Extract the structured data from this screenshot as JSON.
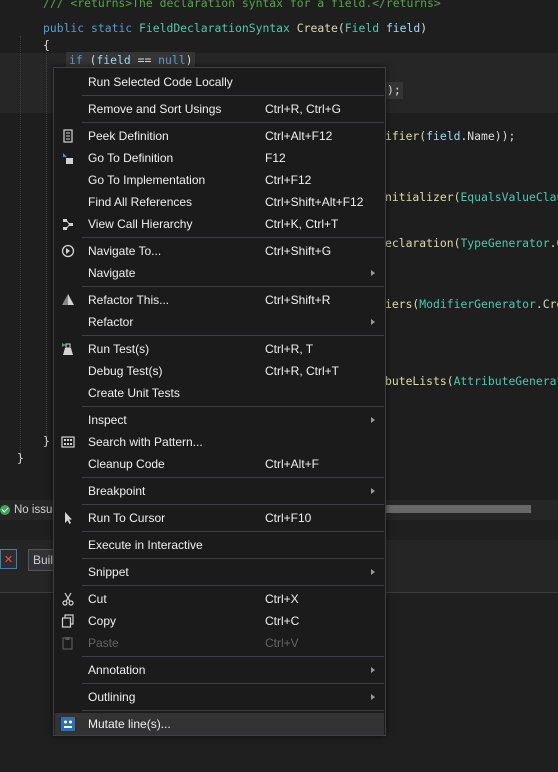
{
  "editor": {
    "comment_line": "/// <returns>The declaration syntax for a field.</returns>",
    "sig_kw1": "public",
    "sig_kw2": "static",
    "sig_type": "FieldDeclarationSyntax",
    "sig_method": "Create",
    "sig_paramtype": "Field",
    "sig_param": "field",
    "brace_open": "{",
    "if_kw": "if",
    "if_var": "field",
    "if_op": "==",
    "if_null": "null",
    "frag_1": ");",
    "frag_2a": "ifier(",
    "frag_2b": "field",
    "frag_2c": ".Name));",
    "frag_3a": "nitializer(",
    "frag_3b": "EqualsValueClause",
    "frag_4a": "eclaration(",
    "frag_4b": "TypeGenerator",
    "frag_4c": ".Cr",
    "frag_5a": "iers(",
    "frag_5b": "ModifierGenerator",
    "frag_5c": ".Creat",
    "frag_6a": "buteLists(",
    "frag_6b": "AttributeGenerato",
    "brace_close_inner": "}",
    "brace_close_outer": "}"
  },
  "status": {
    "issues_text": "No issue"
  },
  "lower_panel": {
    "build_label": "Buil"
  },
  "context_menu": {
    "items": [
      {
        "label": "Run Selected Code Locally",
        "shortcut": "",
        "icon": "",
        "submenu": false,
        "disabled": false
      },
      {
        "label": "Remove and Sort Usings",
        "shortcut": "Ctrl+R, Ctrl+G",
        "icon": "",
        "submenu": false,
        "disabled": false
      },
      {
        "label": "Peek Definition",
        "shortcut": "Ctrl+Alt+F12",
        "icon": "peek-definition-icon",
        "submenu": false,
        "disabled": false
      },
      {
        "label": "Go To Definition",
        "shortcut": "F12",
        "icon": "go-to-definition-icon",
        "submenu": false,
        "disabled": false
      },
      {
        "label": "Go To Implementation",
        "shortcut": "Ctrl+F12",
        "icon": "",
        "submenu": false,
        "disabled": false
      },
      {
        "label": "Find All References",
        "shortcut": "Ctrl+Shift+Alt+F12",
        "icon": "",
        "submenu": false,
        "disabled": false
      },
      {
        "label": "View Call Hierarchy",
        "shortcut": "Ctrl+K, Ctrl+T",
        "icon": "call-hierarchy-icon",
        "submenu": false,
        "disabled": false
      },
      {
        "label": "Navigate To...",
        "shortcut": "Ctrl+Shift+G",
        "icon": "navigate-to-icon",
        "submenu": false,
        "disabled": false
      },
      {
        "label": "Navigate",
        "shortcut": "",
        "icon": "",
        "submenu": true,
        "disabled": false
      },
      {
        "label": "Refactor This...",
        "shortcut": "Ctrl+Shift+R",
        "icon": "refactor-icon",
        "submenu": false,
        "disabled": false
      },
      {
        "label": "Refactor",
        "shortcut": "",
        "icon": "",
        "submenu": true,
        "disabled": false
      },
      {
        "label": "Run Test(s)",
        "shortcut": "Ctrl+R, T",
        "icon": "run-tests-icon",
        "submenu": false,
        "disabled": false
      },
      {
        "label": "Debug Test(s)",
        "shortcut": "Ctrl+R, Ctrl+T",
        "icon": "",
        "submenu": false,
        "disabled": false
      },
      {
        "label": "Create Unit Tests",
        "shortcut": "",
        "icon": "",
        "submenu": false,
        "disabled": false
      },
      {
        "label": "Inspect",
        "shortcut": "",
        "icon": "",
        "submenu": true,
        "disabled": false
      },
      {
        "label": "Search with Pattern...",
        "shortcut": "",
        "icon": "search-pattern-icon",
        "submenu": false,
        "disabled": false
      },
      {
        "label": "Cleanup Code",
        "shortcut": "Ctrl+Alt+F",
        "icon": "",
        "submenu": false,
        "disabled": false
      },
      {
        "label": "Breakpoint",
        "shortcut": "",
        "icon": "",
        "submenu": true,
        "disabled": false
      },
      {
        "label": "Run To Cursor",
        "shortcut": "Ctrl+F10",
        "icon": "cursor-icon",
        "submenu": false,
        "disabled": false
      },
      {
        "label": "Execute in Interactive",
        "shortcut": "",
        "icon": "",
        "submenu": false,
        "disabled": false
      },
      {
        "label": "Snippet",
        "shortcut": "",
        "icon": "",
        "submenu": true,
        "disabled": false
      },
      {
        "label": "Cut",
        "shortcut": "Ctrl+X",
        "icon": "scissors-icon",
        "submenu": false,
        "disabled": false
      },
      {
        "label": "Copy",
        "shortcut": "Ctrl+C",
        "icon": "copy-icon",
        "submenu": false,
        "disabled": false
      },
      {
        "label": "Paste",
        "shortcut": "Ctrl+V",
        "icon": "paste-icon",
        "submenu": false,
        "disabled": true
      },
      {
        "label": "Annotation",
        "shortcut": "",
        "icon": "",
        "submenu": true,
        "disabled": false
      },
      {
        "label": "Outlining",
        "shortcut": "",
        "icon": "",
        "submenu": true,
        "disabled": false
      },
      {
        "label": "Mutate line(s)...",
        "shortcut": "",
        "icon": "mutate-icon",
        "submenu": false,
        "disabled": false
      }
    ]
  }
}
